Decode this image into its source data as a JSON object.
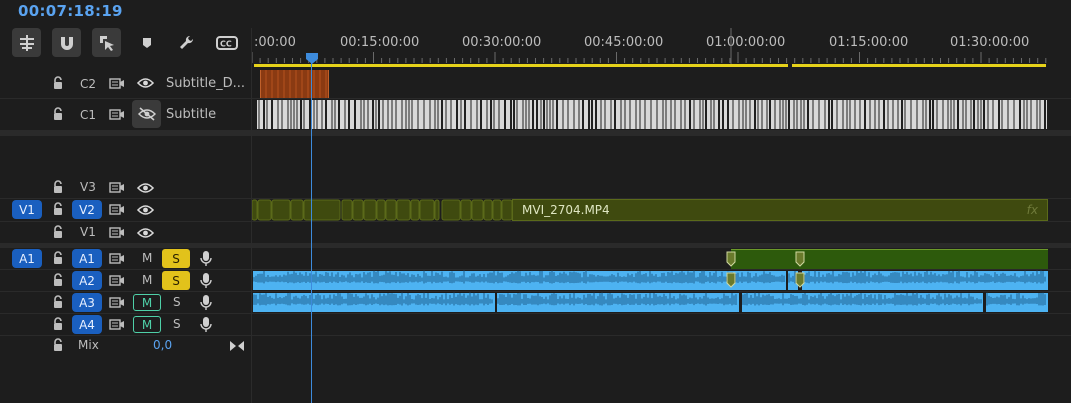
{
  "timecode": "00:07:18:19",
  "ruler": {
    "labels": [
      ":00:00",
      "00:15:00:00",
      "00:30:00:00",
      "00:45:00:00",
      "01:00:00:00",
      "01:15:00:00",
      "01:30:00:00"
    ]
  },
  "tracks": {
    "C2": {
      "label": "C2",
      "name": "Subtitle_D..."
    },
    "C1": {
      "label": "C1",
      "name": "Subtitle"
    },
    "V3": {
      "label": "V3"
    },
    "V2": {
      "label": "V2",
      "source": "V1"
    },
    "V1": {
      "label": "V1"
    },
    "A1": {
      "label": "A1",
      "source": "A1",
      "mute": "M",
      "solo": "S"
    },
    "A2": {
      "label": "A2",
      "mute": "M",
      "solo": "S"
    },
    "A3": {
      "label": "A3",
      "mute": "M",
      "solo": "S"
    },
    "A4": {
      "label": "A4",
      "mute": "M",
      "solo": "S"
    },
    "Mix": {
      "label": "Mix",
      "value": "0,0"
    }
  },
  "clips": {
    "video_main": "MVI_2704.MP4",
    "fx": "fx"
  },
  "colors": {
    "accent": "#5aa3f0",
    "playhead": "#3d8bdc",
    "work_area": "#e6d21a",
    "video_clip": "#3f4a0f",
    "audio_clip": "#4db3f2",
    "audio_green": "#2d5a0c",
    "subtitle_clip": "#8a3a12"
  }
}
